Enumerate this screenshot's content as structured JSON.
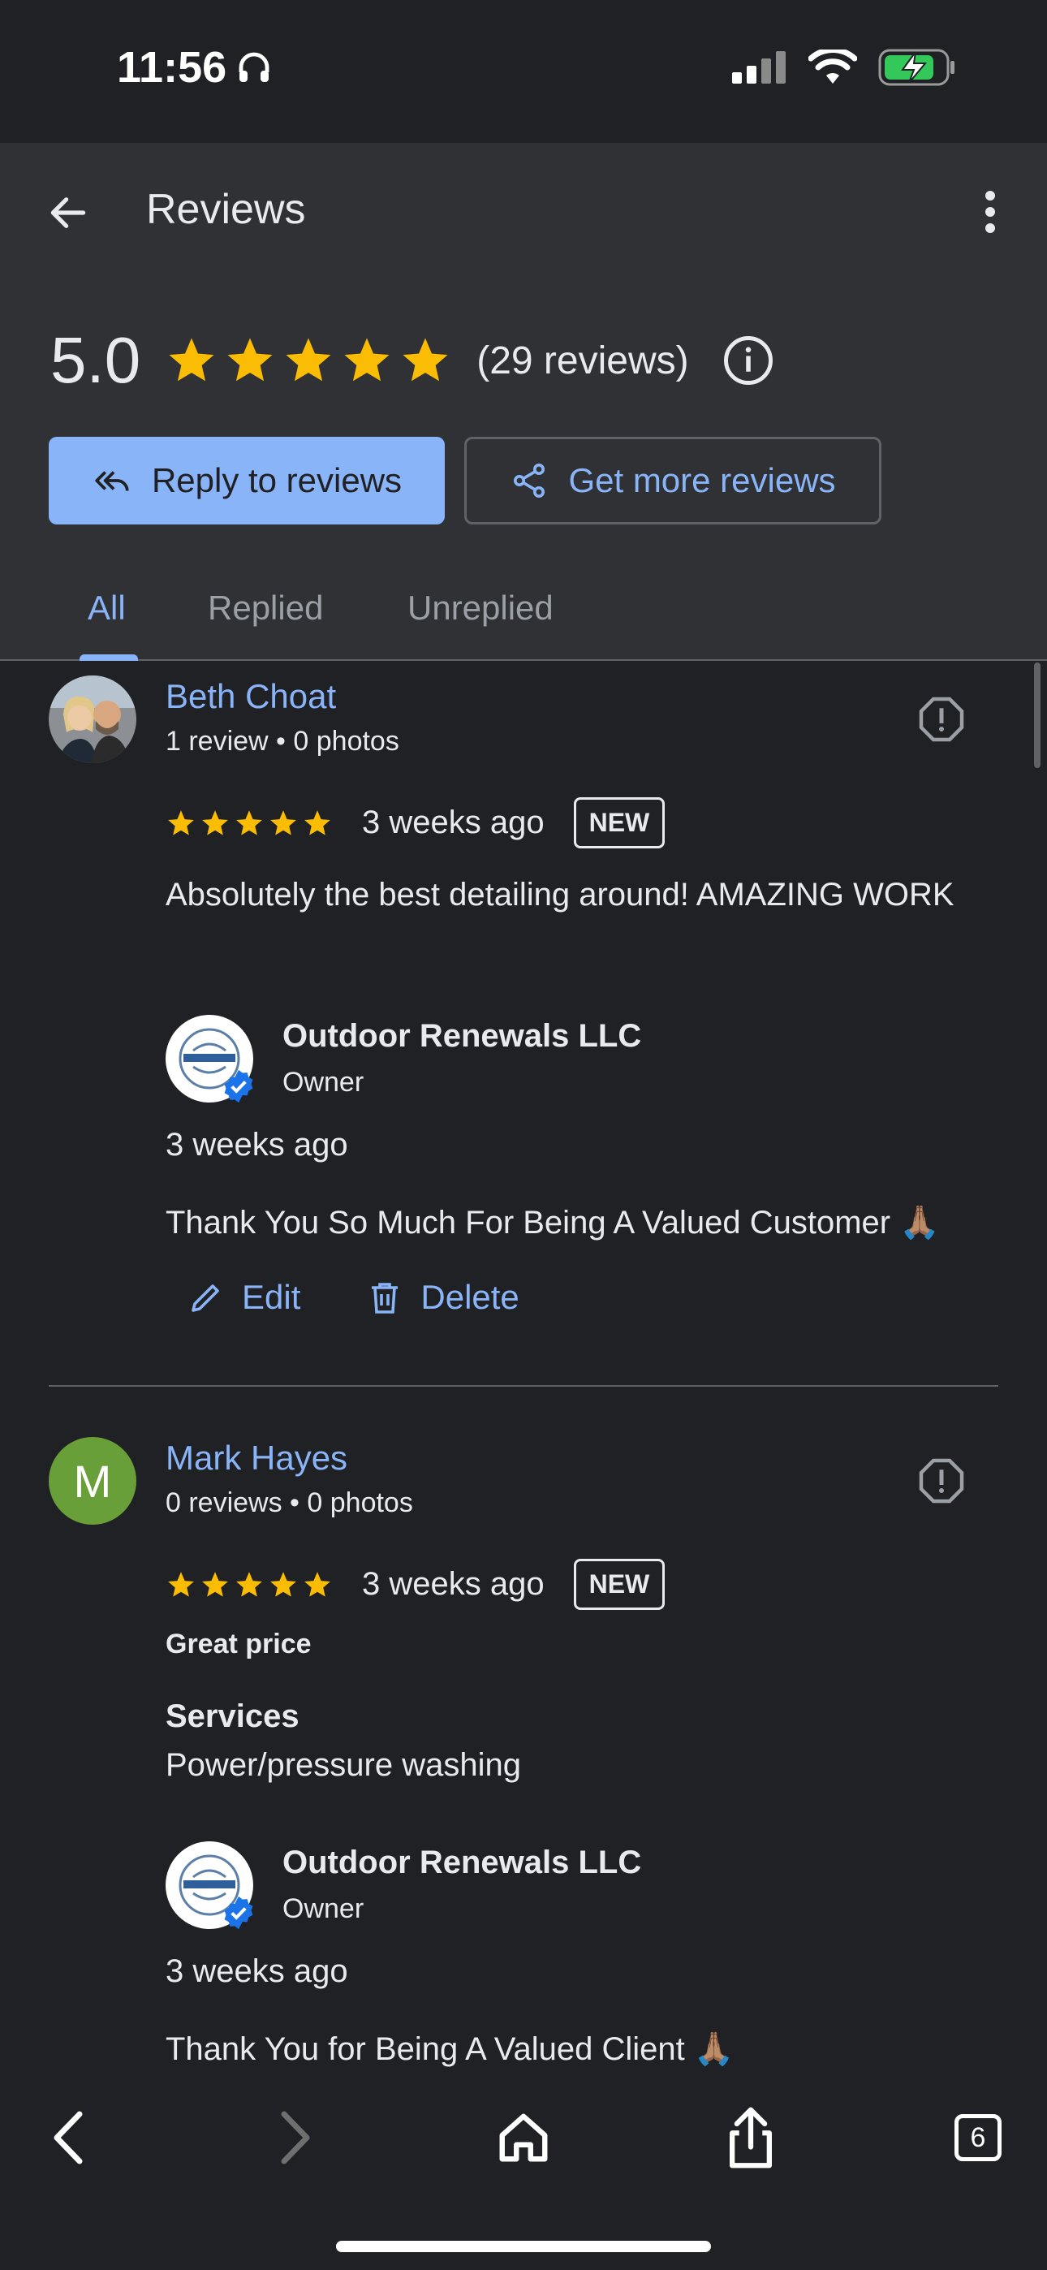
{
  "status_bar": {
    "time": "11:56"
  },
  "header": {
    "title": "Reviews",
    "rating": "5.0",
    "stars": 5,
    "review_count": "(29 reviews)",
    "reply_button": "Reply to reviews",
    "more_reviews_button": "Get more reviews",
    "tabs": [
      {
        "label": "All",
        "active": true
      },
      {
        "label": "Replied",
        "active": false
      },
      {
        "label": "Unreplied",
        "active": false
      }
    ]
  },
  "reviews": [
    {
      "name": "Beth Choat",
      "meta": "1 review • 0 photos",
      "stars": 5,
      "when": "3 weeks ago",
      "badge": "NEW",
      "text": "Absolutely the best detailing around! AMAZING WORK",
      "reply": {
        "owner": "Outdoor Renewals LLC",
        "role": "Owner",
        "when": "3 weeks ago",
        "text": "Thank You So Much For Being A Valued Customer 🙏🏽"
      },
      "actions": {
        "edit": "Edit",
        "delete": "Delete"
      }
    },
    {
      "name": "Mark Hayes",
      "avatar_letter": "M",
      "meta": "0 reviews • 0 photos",
      "stars": 5,
      "when": "3 weeks ago",
      "badge": "NEW",
      "highlight": "Great price",
      "services_label": "Services",
      "services_value": "Power/pressure washing",
      "reply": {
        "owner": "Outdoor Renewals LLC",
        "role": "Owner",
        "when": "3 weeks ago",
        "text": "Thank You for Being A Valued Client 🙏🏽"
      }
    }
  ],
  "toolbar": {
    "tab_count": "6"
  },
  "colors": {
    "accent": "#8ab4f8",
    "star": "#fbbc04",
    "background": "#202124",
    "panel": "#303134"
  },
  "icons": [
    "back-arrow-icon",
    "more-vert-icon",
    "star-icon",
    "info-icon",
    "reply-all-icon",
    "share-icon",
    "flag-icon",
    "verified-badge-icon",
    "edit-pencil-icon",
    "trash-icon",
    "chevron-left-icon",
    "chevron-right-icon",
    "home-icon",
    "share-up-icon",
    "tabs-icon"
  ]
}
